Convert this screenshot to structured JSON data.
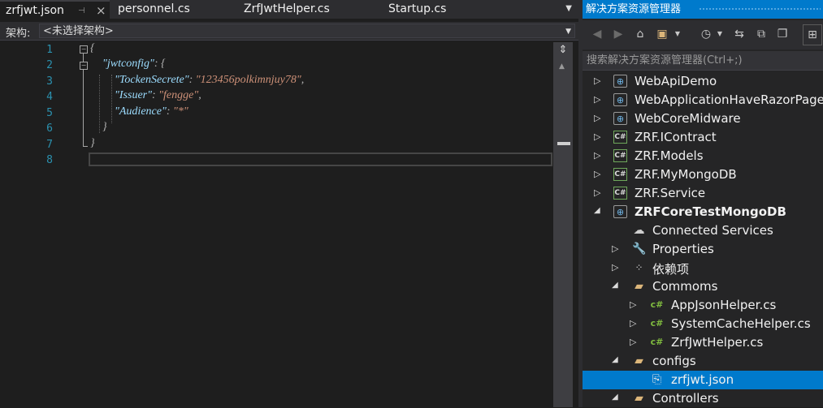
{
  "editor": {
    "tabs": [
      {
        "label": "zrfjwt.json",
        "active": true
      },
      {
        "label": "personnel.cs"
      },
      {
        "label": "ZrfJwtHelper.cs"
      },
      {
        "label": "Startup.cs"
      }
    ],
    "nav_label": "架构:",
    "nav_value": "<未选择架构>",
    "line_numbers": [
      "1",
      "2",
      "3",
      "4",
      "5",
      "6",
      "7",
      "8"
    ],
    "code": {
      "l1_brace": "{",
      "l2_key": "\"jwtconfig\"",
      "l2_rest": ": {",
      "l3_key": "\"TockenSecrete\"",
      "l3_colon": ": ",
      "l3_value": "\"123456polkimnjuy78\"",
      "l3_comma": ",",
      "l4_key": "\"Issuer\"",
      "l4_colon": ": ",
      "l4_value": "\"fengge\"",
      "l4_comma": ",",
      "l5_key": "\"Audience\"",
      "l5_colon": ": ",
      "l5_value": "\"*\"",
      "l6_brace": "}",
      "l7_brace": "}"
    }
  },
  "solution_explorer": {
    "title": "解决方案资源管理器",
    "search_placeholder": "搜索解决方案资源管理器(Ctrl+;)",
    "items": [
      {
        "label": "WebApiDemo",
        "icon": "web-project-icon"
      },
      {
        "label": "WebApplicationHaveRazorPage",
        "icon": "web-project-icon"
      },
      {
        "label": "WebCoreMidware",
        "icon": "web-project-icon"
      },
      {
        "label": "ZRF.IContract",
        "icon": "csharp-project-icon"
      },
      {
        "label": "ZRF.Models",
        "icon": "csharp-project-icon"
      },
      {
        "label": "ZRF.MyMongoDB",
        "icon": "csharp-project-icon"
      },
      {
        "label": "ZRF.Service",
        "icon": "csharp-project-icon"
      },
      {
        "label": "ZRFCoreTestMongoDB",
        "icon": "web-project-icon",
        "expanded": true,
        "bold": true
      },
      {
        "label": "Connected Services",
        "icon": "cloud-icon"
      },
      {
        "label": "Properties",
        "icon": "wrench-icon"
      },
      {
        "label": "依赖项",
        "icon": "dependencies-icon"
      },
      {
        "label": "Commoms",
        "icon": "folder-icon",
        "expanded": true
      },
      {
        "label": "AppJsonHelper.cs",
        "icon": "csharp-file-icon"
      },
      {
        "label": "SystemCacheHelper.cs",
        "icon": "csharp-file-icon"
      },
      {
        "label": "ZrfJwtHelper.cs",
        "icon": "csharp-file-icon"
      },
      {
        "label": "configs",
        "icon": "folder-icon",
        "expanded": true
      },
      {
        "label": "zrfjwt.json",
        "icon": "json-file-icon",
        "selected": true
      },
      {
        "label": "Controllers",
        "icon": "folder-icon",
        "expanded": true
      }
    ]
  }
}
